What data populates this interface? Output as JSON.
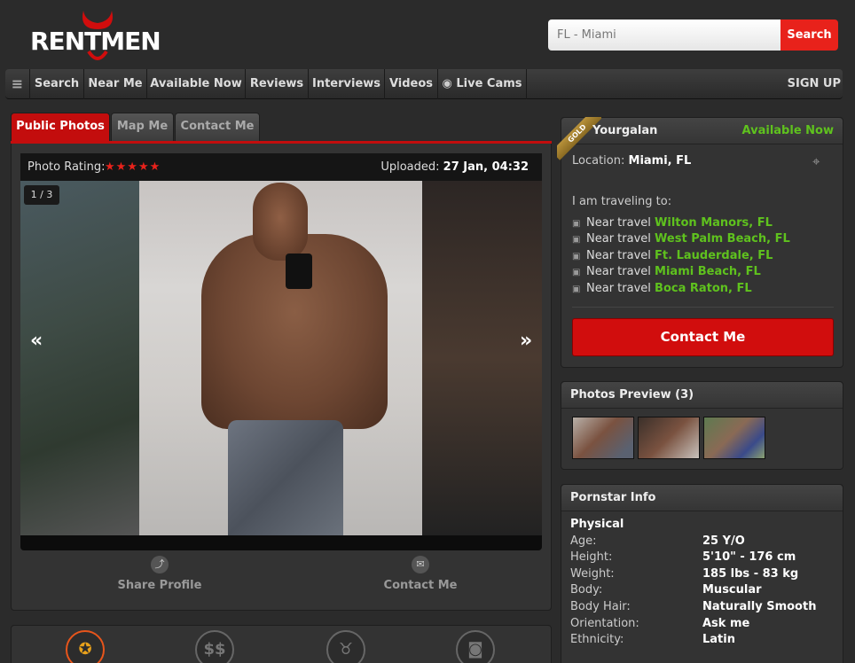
{
  "header": {
    "logo_text": "RENTMEN",
    "search_value": "FL - Miami",
    "search_button": "Search"
  },
  "nav": {
    "items": [
      "Search",
      "Near Me",
      "Available Now",
      "Reviews",
      "Interviews",
      "Videos",
      "Live Cams"
    ],
    "menu_icon": "hamburger-icon",
    "signup": "SIGN UP"
  },
  "tabs": [
    "Public Photos",
    "Map Me",
    "Contact Me"
  ],
  "gallery": {
    "rating_label": "Photo Rating:",
    "stars": "★★★★★",
    "uploaded_label": "Uploaded:",
    "uploaded_value": "27 Jan, 04:32",
    "counter": "1 / 3",
    "prev": "«",
    "next": "»"
  },
  "actions": {
    "share": "Share Profile",
    "contact": "Contact Me"
  },
  "profile": {
    "badge": "GOLD",
    "username": "Yourgalan",
    "availability": "Available Now",
    "location_label": "Location:",
    "location_value": "Miami, FL",
    "travel_heading": "I am traveling to:",
    "travel_prefix": "Near travel",
    "travel_cities": [
      "Wilton Manors, FL",
      "West Palm Beach, FL",
      "Ft. Lauderdale, FL",
      "Miami Beach, FL",
      "Boca Raton, FL"
    ],
    "contact_button": "Contact Me"
  },
  "photos_preview": {
    "title": "Photos Preview (3)"
  },
  "pornstar_info": {
    "title": "Pornstar Info",
    "section": "Physical",
    "rows": [
      {
        "label": "Age:",
        "value": "25 Y/O"
      },
      {
        "label": "Height:",
        "value": "5'10\" - 176 cm"
      },
      {
        "label": "Weight:",
        "value": "185 lbs - 83 kg"
      },
      {
        "label": "Body:",
        "value": "Muscular"
      },
      {
        "label": "Body Hair:",
        "value": "Naturally Smooth"
      },
      {
        "label": "Orientation:",
        "value": "Ask me"
      },
      {
        "label": "Ethnicity:",
        "value": "Latin"
      }
    ]
  },
  "colors": {
    "accent_red": "#e8221b",
    "available_green": "#5fc21e"
  }
}
